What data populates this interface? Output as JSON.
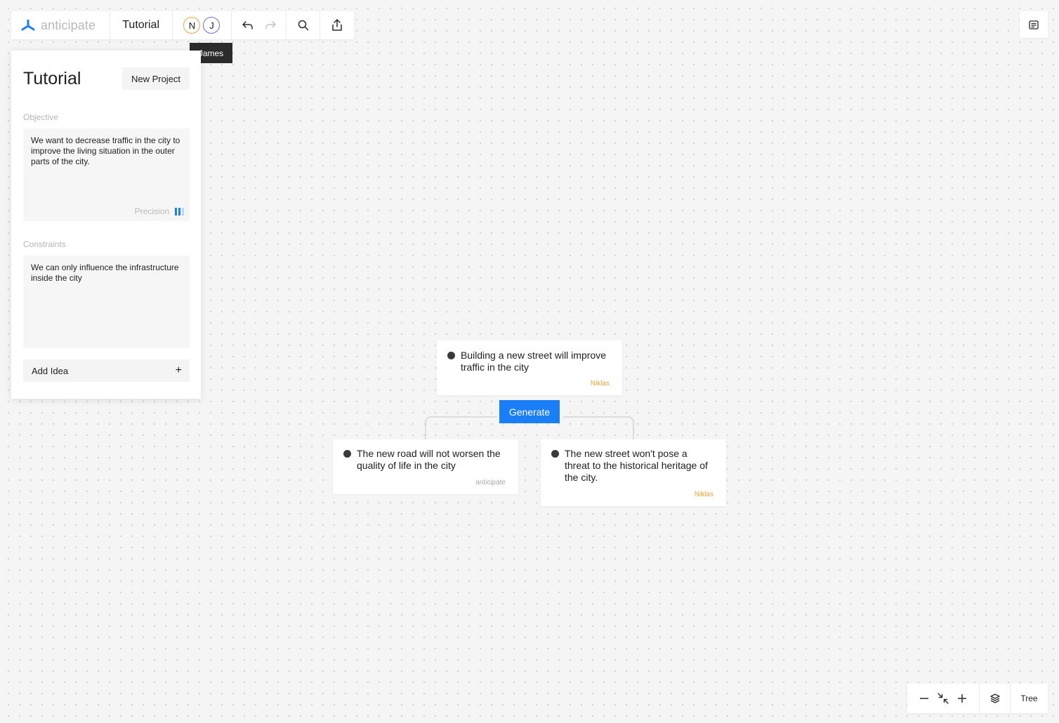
{
  "app": {
    "logo_text": "anticipate",
    "project_name": "Tutorial"
  },
  "collaborators": [
    {
      "initial": "N",
      "color": "#f0a13a"
    },
    {
      "initial": "J",
      "color": "#6b6bd6"
    }
  ],
  "tooltip": {
    "text": "James"
  },
  "panel": {
    "title": "Tutorial",
    "new_project_label": "New Project",
    "objective_label": "Objective",
    "objective_text": "We want to decrease traffic in the city to improve the living situation in the outer parts of the city.",
    "precision_label": "Precision",
    "precision_level": 2,
    "precision_max": 3,
    "constraints_label": "Constraints",
    "constraints_text": "We can only influence the infrastructure inside the city",
    "add_idea_label": "Add Idea",
    "add_icon": "+"
  },
  "tree": {
    "root": {
      "text": "Building a new street will improve traffic in the city",
      "author": "Niklas"
    },
    "generate_label": "Generate",
    "children": [
      {
        "text": "The new road will not worsen the quality of life in the city",
        "author": "anticipate"
      },
      {
        "text": "The new street won't pose a threat to the historical heritage of the city.",
        "author": "Niklas"
      }
    ]
  },
  "bottom_bar": {
    "view_label": "Tree"
  },
  "colors": {
    "accent": "#1a7ff6",
    "author_orange": "#f0a13a",
    "author_gray": "#a8a8a8",
    "precision_light": "#b9d6fb"
  }
}
